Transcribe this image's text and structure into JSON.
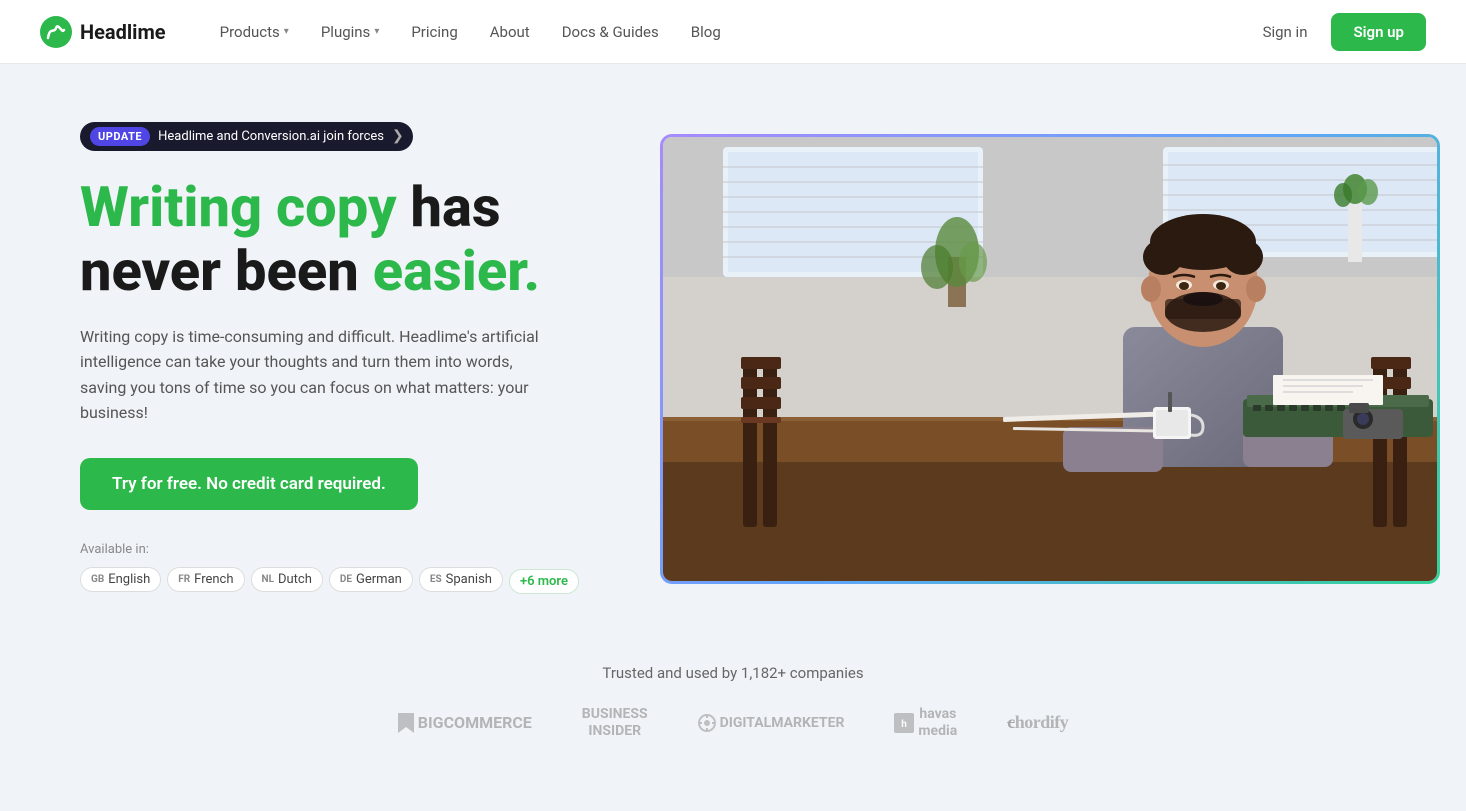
{
  "nav": {
    "logo_text": "Headlime",
    "links": [
      {
        "label": "Products",
        "has_dropdown": true
      },
      {
        "label": "Plugins",
        "has_dropdown": true
      },
      {
        "label": "Pricing",
        "has_dropdown": false
      },
      {
        "label": "About",
        "has_dropdown": false
      },
      {
        "label": "Docs & Guides",
        "has_dropdown": false
      },
      {
        "label": "Blog",
        "has_dropdown": false
      }
    ],
    "signin_label": "Sign in",
    "signup_label": "Sign up"
  },
  "hero": {
    "badge": {
      "tag": "UPDATE",
      "text": "Headlime and Conversion.ai join forces",
      "arrow": "❯"
    },
    "headline_part1": "Writing copy",
    "headline_part2": " has\nnever been ",
    "headline_part3": "easier.",
    "description": "Writing copy is time-consuming and difficult. Headlime's artificial intelligence can take your thoughts and turn them into words, saving you tons of time so you can focus on what matters: your business!",
    "cta_label": "Try for free. No credit card required.",
    "available_label": "Available in:",
    "languages": [
      {
        "code": "GB",
        "name": "English"
      },
      {
        "code": "FR",
        "name": "French"
      },
      {
        "code": "NL",
        "name": "Dutch"
      },
      {
        "code": "DE",
        "name": "German"
      },
      {
        "code": "ES",
        "name": "Spanish"
      }
    ],
    "more_label": "+6 more"
  },
  "trusted": {
    "title": "Trusted and used by 1,182+ companies",
    "logos": [
      {
        "name": "BigCommerce",
        "display": "BIGCOMMERCE"
      },
      {
        "name": "Business Insider",
        "display": "BUSINESS\nINSIDER"
      },
      {
        "name": "Digital Marketer",
        "display": "⚙ DIGITALMARKETER"
      },
      {
        "name": "Havas Media",
        "display": "havas\nmedia"
      },
      {
        "name": "Chordify",
        "display": "chordify"
      }
    ]
  }
}
